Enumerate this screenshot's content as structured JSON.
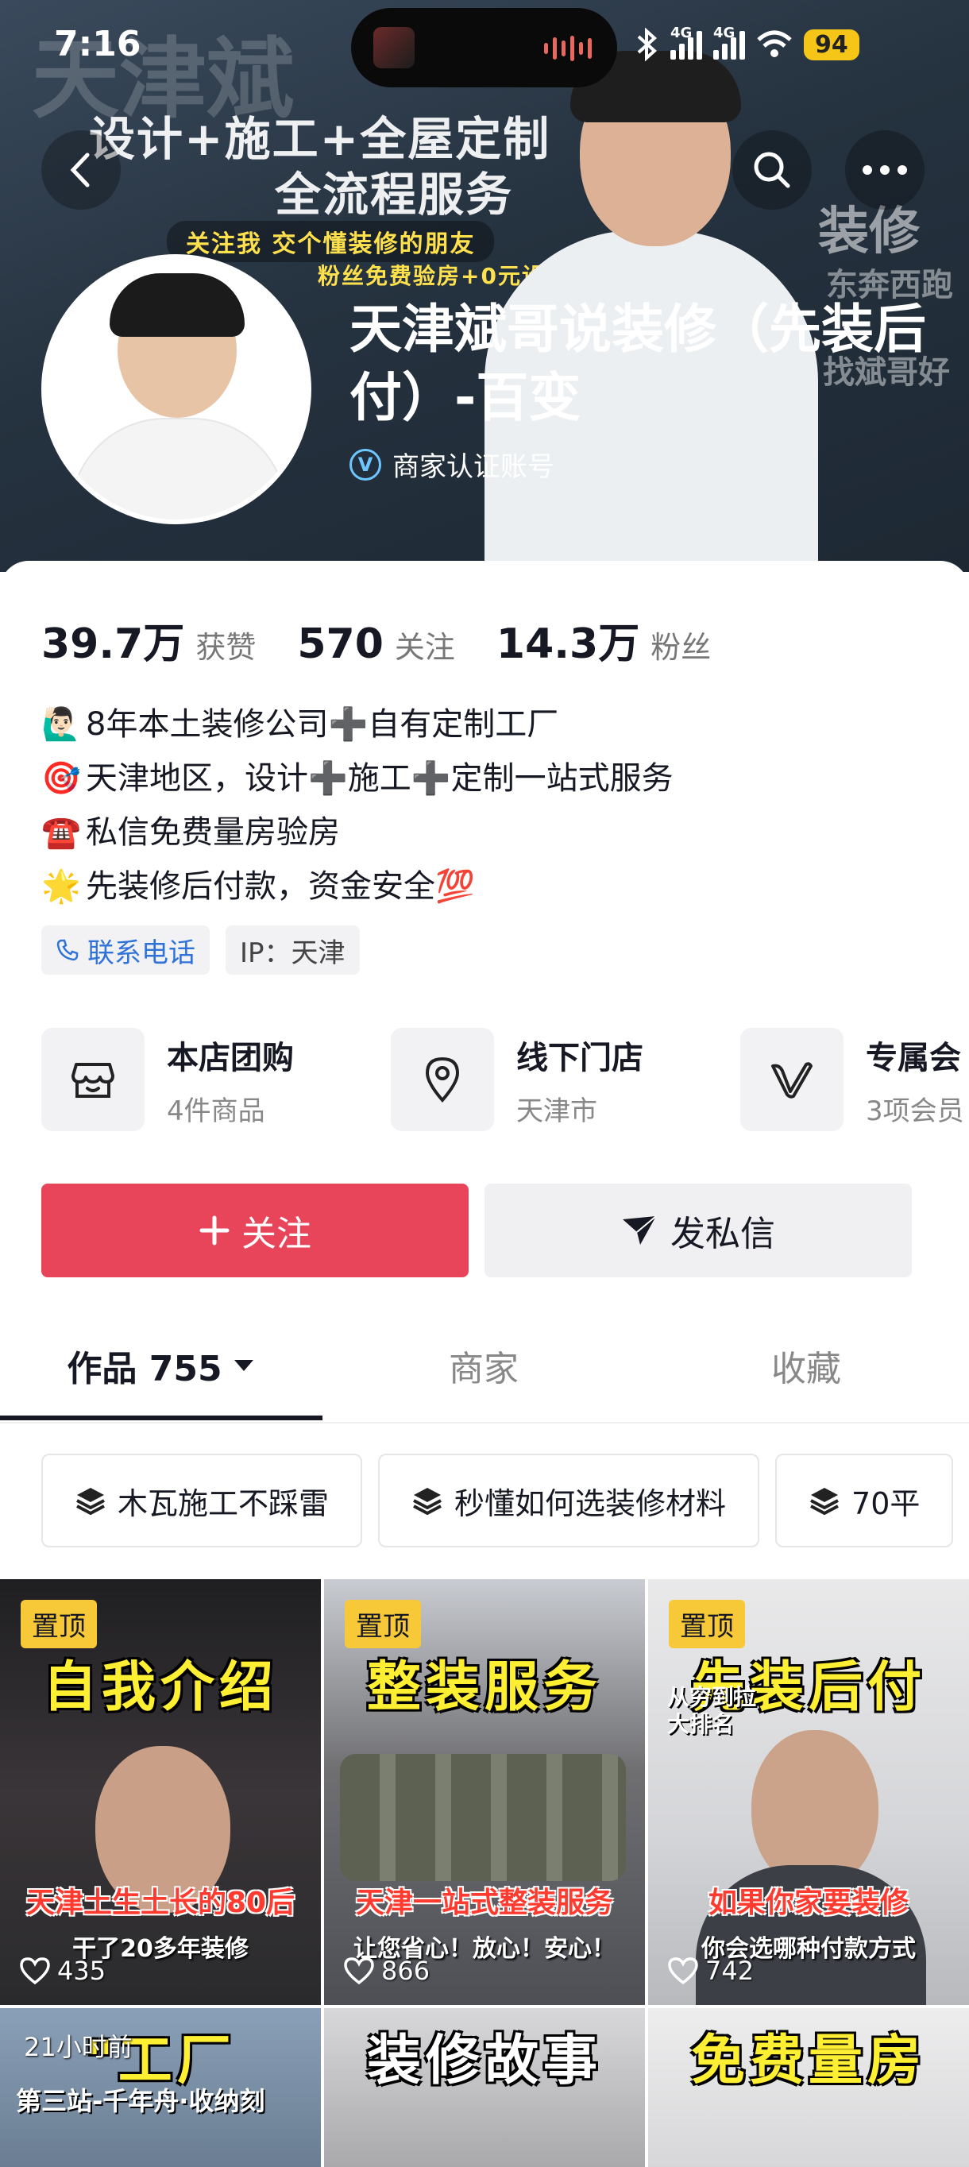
{
  "status_bar": {
    "time": "7:16",
    "battery": "94",
    "net1": "4G",
    "net2": "4G"
  },
  "banner": {
    "line1": "设计+施工+全屋定制",
    "line2": "全流程服务",
    "line3": "关注我 交个懂装修的朋友",
    "line4": "粉丝免费验房+0元设计",
    "side1": "装修",
    "side2": "东奔西跑",
    "side3": "找斌哥好",
    "bgmark": "天津斌"
  },
  "profile": {
    "name": "天津斌哥说装修（先装后付）-百变",
    "verified_label": "商家认证账号"
  },
  "stats": [
    {
      "num": "39.7万",
      "label": "获赞"
    },
    {
      "num": "570",
      "label": "关注"
    },
    {
      "num": "14.3万",
      "label": "粉丝"
    }
  ],
  "bio": [
    {
      "emoji": "🙋🏻‍♂️",
      "text": "8年本土装修公司➕自有定制工厂"
    },
    {
      "emoji": "🎯",
      "text": "天津地区，设计➕施工➕定制一站式服务"
    },
    {
      "emoji": "☎️",
      "text": "私信免费量房验房"
    },
    {
      "emoji": "🌟",
      "text": "先装修后付款，资金安全💯"
    }
  ],
  "tags": {
    "phone": "联系电话",
    "ip": "IP：天津"
  },
  "services": [
    {
      "title": "本店团购",
      "sub": "4件商品",
      "icon": "store-icon"
    },
    {
      "title": "线下门店",
      "sub": "天津市",
      "icon": "location-pin-icon"
    },
    {
      "title": "专属会",
      "sub": "3项会员",
      "icon": "member-v-icon"
    }
  ],
  "buttons": {
    "follow": "关注",
    "message": "发私信"
  },
  "tabs": [
    {
      "label": "作品 755"
    },
    {
      "label": "商家"
    },
    {
      "label": "收藏"
    }
  ],
  "chips": [
    "木瓦施工不踩雷",
    "秒懂如何选装修材料",
    "70平"
  ],
  "videos": [
    {
      "pin": "置顶",
      "title": "自我介绍",
      "sub1": "天津土生土长的80后",
      "sub2": "干了20多年装修",
      "likes": "435"
    },
    {
      "pin": "置顶",
      "title": "整装服务",
      "sub1": "天津一站式整装服务",
      "sub2": "让您省心！放心！安心！",
      "likes": "866"
    },
    {
      "pin": "置顶",
      "title": "先装后付",
      "sub1": "如果你家要装修",
      "sub2": "你会选哪种付款方式",
      "likes": "742",
      "extra": "从穷到拉\n大排名"
    },
    {
      "ago": "21小时前",
      "title": "\"工厂",
      "sub3": "第三站-千年舟·收纳刻"
    },
    {
      "title": "装修故事"
    },
    {
      "title": "免费量房"
    }
  ]
}
